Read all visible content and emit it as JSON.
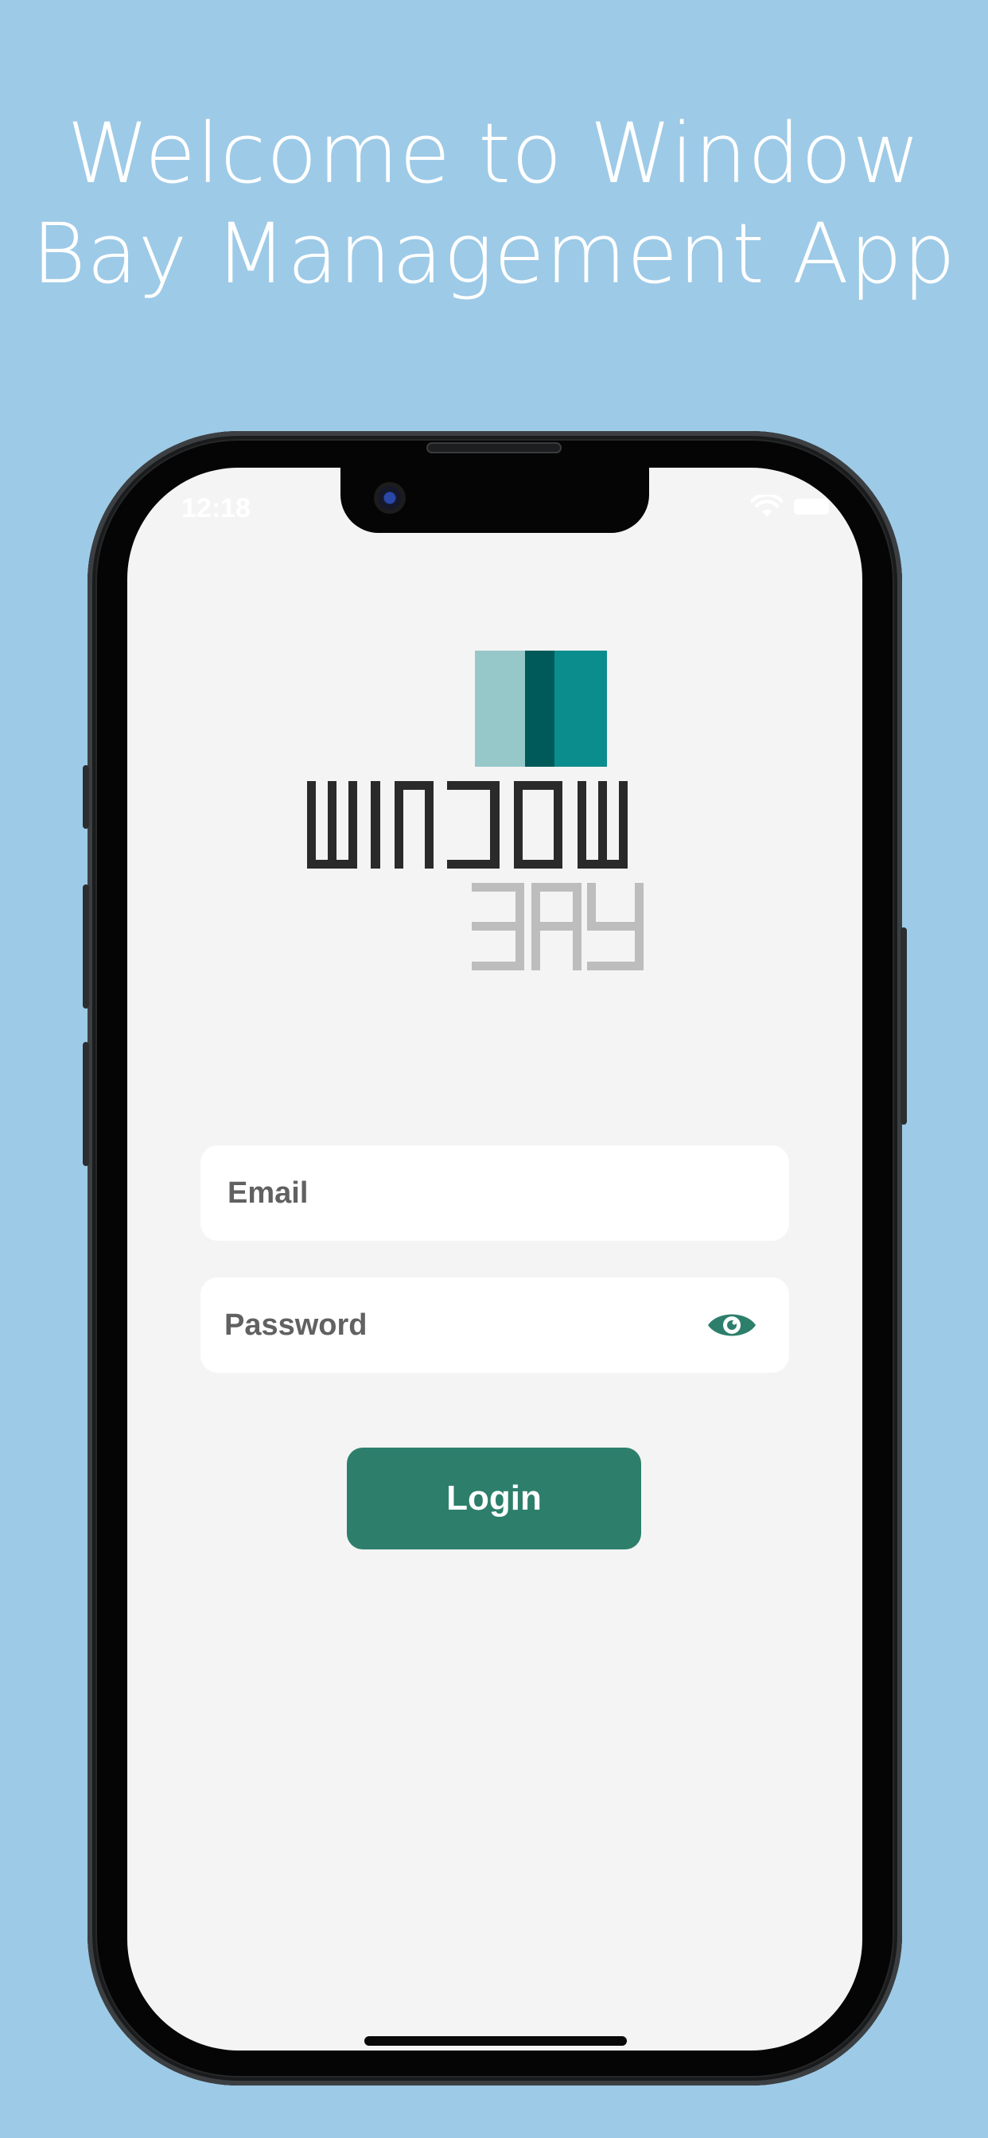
{
  "headline": {
    "line1": "Welcome to Window",
    "line2": "Bay Management App"
  },
  "status_bar": {
    "time": "12:18",
    "icons": [
      "wifi-icon",
      "battery-icon"
    ]
  },
  "logo": {
    "word_top": "WINDOW",
    "word_bottom": "BAY",
    "colors": {
      "light_teal": "#97c8c9",
      "dark_teal": "#005a5a",
      "mid_teal": "#0c8d8d",
      "dark_text": "#2a2a2a",
      "grey_text": "#bdbdbd"
    }
  },
  "login_form": {
    "email_placeholder": "Email",
    "password_placeholder": "Password",
    "show_password_icon": "eye-icon",
    "login_label": "Login"
  },
  "colors": {
    "background": "#9dcae7",
    "accent": "#2d7f6c",
    "screen": "#f4f4f4"
  }
}
